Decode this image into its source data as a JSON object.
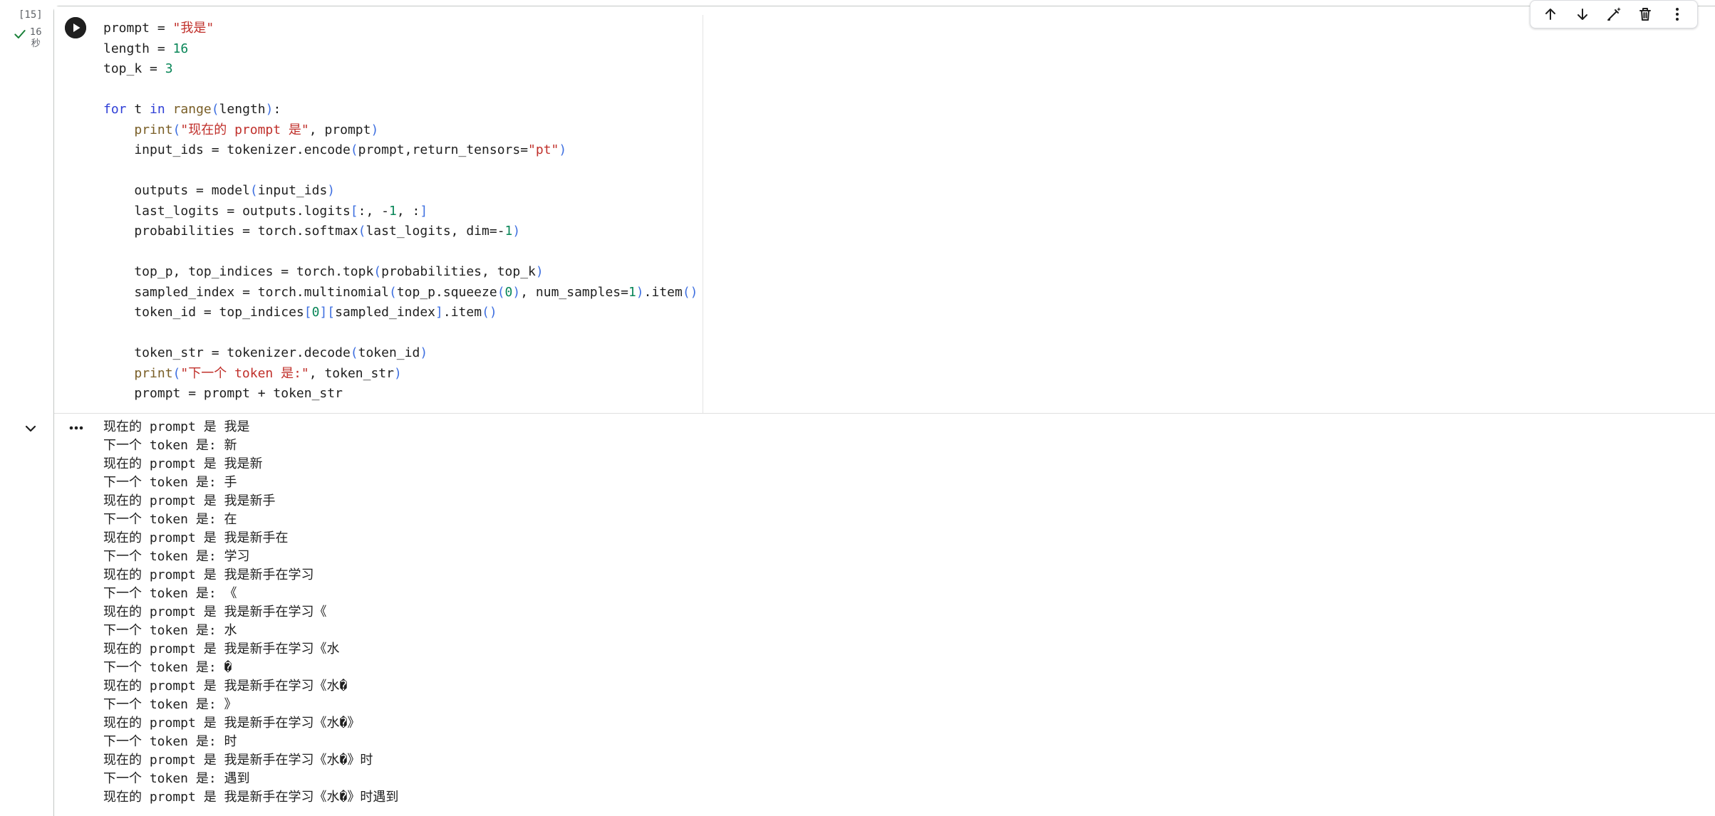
{
  "cell": {
    "execution_count": "[15]",
    "run_time_value": "16",
    "run_time_unit": "秒",
    "status": "completed"
  },
  "toolbar": {
    "buttons": [
      "move-up",
      "move-down",
      "edit-with-ai",
      "delete",
      "more-options"
    ]
  },
  "code_lines": [
    "prompt = \"我是\"",
    "length = 16",
    "top_k = 3",
    "",
    "for t in range(length):",
    "    print(\"现在的 prompt 是\", prompt)",
    "    input_ids = tokenizer.encode(prompt,return_tensors=\"pt\")",
    "",
    "    outputs = model(input_ids)",
    "    last_logits = outputs.logits[:, -1, :]",
    "    probabilities = torch.softmax(last_logits, dim=-1)",
    "",
    "    top_p, top_indices = torch.topk(probabilities, top_k)",
    "    sampled_index = torch.multinomial(top_p.squeeze(0), num_samples=1).item()",
    "    token_id = top_indices[0][sampled_index].item()",
    "",
    "    token_str = tokenizer.decode(token_id)",
    "    print(\"下一个 token 是:\", token_str)",
    "    prompt = prompt + token_str"
  ],
  "output_lines": [
    "现在的 prompt 是 我是",
    "下一个 token 是: 新",
    "现在的 prompt 是 我是新",
    "下一个 token 是: 手",
    "现在的 prompt 是 我是新手",
    "下一个 token 是: 在",
    "现在的 prompt 是 我是新手在",
    "下一个 token 是: 学习",
    "现在的 prompt 是 我是新手在学习",
    "下一个 token 是: 《",
    "现在的 prompt 是 我是新手在学习《",
    "下一个 token 是: 水",
    "现在的 prompt 是 我是新手在学习《水",
    "下一个 token 是: �",
    "现在的 prompt 是 我是新手在学习《水�",
    "下一个 token 是: 》",
    "现在的 prompt 是 我是新手在学习《水�》",
    "下一个 token 是: 时",
    "现在的 prompt 是 我是新手在学习《水�》时",
    "下一个 token 是: 遇到",
    "现在的 prompt 是 我是新手在学习《水�》时遇到"
  ],
  "colors": {
    "keyword": "#2e3ed6",
    "function": "#795e26",
    "string": "#c0302b",
    "number": "#098658",
    "check": "#188038"
  }
}
